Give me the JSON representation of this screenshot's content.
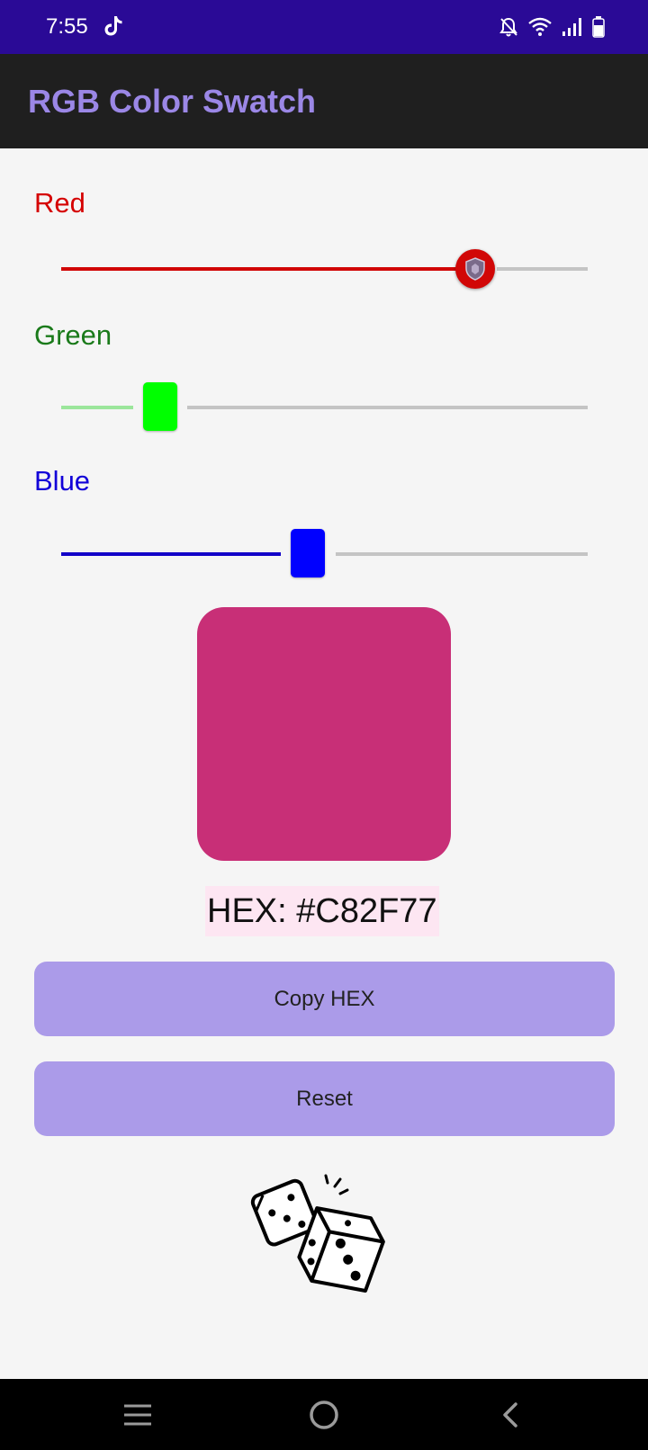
{
  "status_bar": {
    "time": "7:55",
    "icons": [
      "tiktok-icon",
      "bell-off-icon",
      "wifi-icon",
      "signal-icon",
      "battery-icon"
    ]
  },
  "app_bar": {
    "title": "RGB Color Swatch"
  },
  "sliders": {
    "red": {
      "label": "Red",
      "color": "#d50000",
      "track_fill": "#d10707",
      "fill_fraction": 0.787,
      "thumb_icon": "shield-icon"
    },
    "green": {
      "label": "Green",
      "color": "#1a7a1a",
      "track_fill": "#9be69b",
      "thumb_color": "#00ff00",
      "fill_fraction": 0.184
    },
    "blue": {
      "label": "Blue",
      "color": "#1200d8",
      "track_fill": "#1200c8",
      "thumb_color": "#0000ff",
      "fill_fraction": 0.467
    }
  },
  "swatch": {
    "color": "#C82F77"
  },
  "hex": {
    "text": "HEX: #C82F77"
  },
  "buttons": {
    "copy_label": "Copy HEX",
    "reset_label": "Reset"
  },
  "decor": {
    "dice_icon": "dice-icon"
  },
  "nav_bar": {
    "icons": [
      "recents-icon",
      "home-icon",
      "back-icon"
    ]
  },
  "colors": {
    "status_bar": "#2a0a96",
    "app_bar": "#1f1f1f",
    "title": "#9b87e6",
    "button": "#ab9be9",
    "track_inactive": "#c4c4c4",
    "background": "#f5f5f5"
  }
}
